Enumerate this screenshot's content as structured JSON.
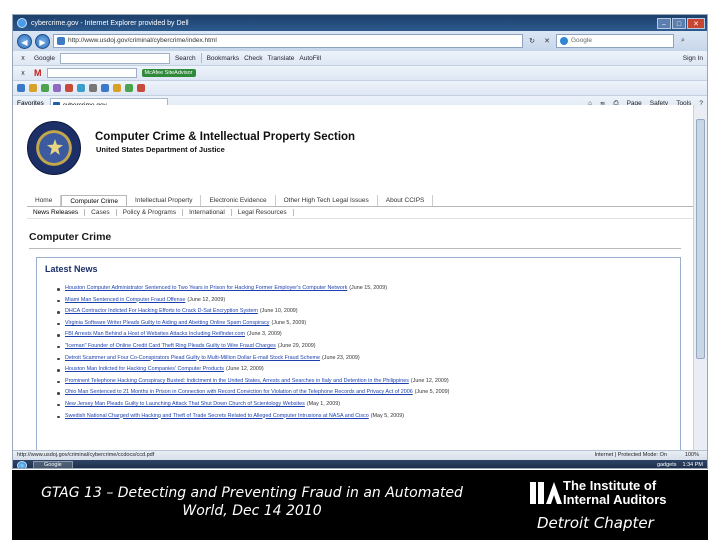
{
  "browser": {
    "title": "cybercrime.gov - Internet Explorer provided by Dell",
    "address": "http://www.usdoj.gov/criminal/cybercrime/index.html",
    "search_placeholder": "Google",
    "toolbar_search_label": "Google",
    "toolbar_items": [
      "Search",
      "Bookmarks",
      "Check",
      "Translate",
      "AutoFill",
      "Sign In"
    ],
    "mcafee_label": "McAfee SiteAdvisor",
    "favorites_label": "Favorites",
    "tab_label": "cybercrime.gov",
    "command_items": [
      "Page",
      "Safety",
      "Tools"
    ]
  },
  "site": {
    "title": "Computer Crime & Intellectual Property Section",
    "subtitle": "United States Department of Justice",
    "nav_tabs": [
      "Home",
      "Computer Crime",
      "Intellectual Property",
      "Electronic Evidence",
      "Other High Tech Legal Issues",
      "About CCIPS"
    ],
    "sub_tabs": [
      "News Releases",
      "Cases",
      "Policy & Programs",
      "International",
      "Legal Resources"
    ],
    "page_heading": "Computer Crime",
    "news_title": "Latest News",
    "news": [
      {
        "text": "Houston Computer Administrator Sentenced to Two Years in Prison for Hacking Former Employer's Computer Network",
        "date": "(June 15, 2009)"
      },
      {
        "text": "Miami Man Sentenced in Computer Fraud Offense",
        "date": "(June 12, 2009)"
      },
      {
        "text": "DHCA Contractor Indicted For Hacking Efforts to Crack D-Sat Encryption System",
        "date": "(June 10, 2009)"
      },
      {
        "text": "Virginia Software Writer Pleads Guilty to Aiding and Abetting Online Spam Conspiracy",
        "date": "(June 5, 2009)"
      },
      {
        "text": "FBI Arrests Man Behind a Host of Websites Attacks Including Reifinder.com",
        "date": "(June 3, 2009)"
      },
      {
        "text": "\"Iceman\" Founder of Online Credit Card Theft Ring Pleads Guilty to Wire Fraud Charges",
        "date": "(June 29, 2009)"
      },
      {
        "text": "Detroit Scammer and Four Co-Conspirators Plead Guilty to Multi-Million Dollar E-mail Stock Fraud Scheme",
        "date": "(June 23, 2009)"
      },
      {
        "text": "Houston Man Indicted for Hacking Companies' Computer Products",
        "date": "(June 12, 2009)"
      },
      {
        "text": "Prominent Telephone Hacking Conspiracy Busted: Indictment in the United States, Arrests and Searches in Italy and Detention in the Philippines",
        "date": "(June 12, 2009)"
      },
      {
        "text": "Ohio Man Sentenced to 21 Months in Prison in Connection with Record Conviction for Violation of the Telephone Records and Privacy Act of 2006",
        "date": "(June 5, 2009)"
      },
      {
        "text": "New Jersey Man Pleads Guilty to Launching Attack That Shut Down Church of Scientology Websites",
        "date": "(May 1, 2009)"
      },
      {
        "text": "Swedish National Charged with Hacking and Theft of Trade Secrets Related to Alleged Computer Intrusions at NASA and Cisco",
        "date": "(May 5, 2009)"
      }
    ]
  },
  "statusbar": {
    "url": "http://www.usdoj.gov/criminal/cybercrime/ccdocs/ccd.pdf",
    "mode": "Internet | Protected Mode: On",
    "zoom": "100%"
  },
  "taskbar": {
    "task_label": "Google",
    "tray_app": "gadgets",
    "clock": "1:34 PM"
  },
  "slide": {
    "caption": "GTAG 13 – Detecting and Preventing Fraud in an Automated World, Dec 14 2010",
    "org_line1": "The Institute of",
    "org_line2": "Internal Auditors",
    "chapter": "Detroit Chapter"
  }
}
